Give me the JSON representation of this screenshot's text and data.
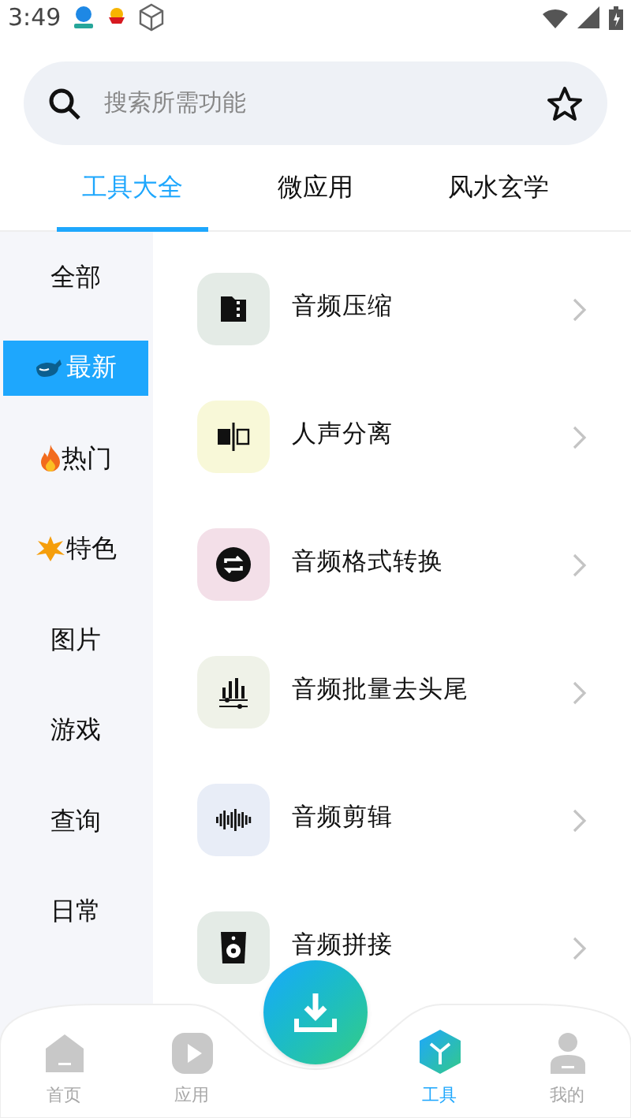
{
  "status_bar": {
    "time": "3:49"
  },
  "search": {
    "placeholder": "搜索所需功能"
  },
  "tabs": [
    {
      "label": "工具大全",
      "selected": true
    },
    {
      "label": "微应用",
      "selected": false
    },
    {
      "label": "风水玄学",
      "selected": false
    }
  ],
  "sidebar": {
    "items": [
      {
        "label": "全部",
        "selected": false
      },
      {
        "label": "最新",
        "selected": true
      },
      {
        "label": "热门",
        "selected": false
      },
      {
        "label": "特色",
        "selected": false
      },
      {
        "label": "图片",
        "selected": false
      },
      {
        "label": "游戏",
        "selected": false
      },
      {
        "label": "查询",
        "selected": false
      },
      {
        "label": "日常",
        "selected": false
      }
    ]
  },
  "tools": [
    {
      "label": "音频压缩",
      "color": "#e4ebe6"
    },
    {
      "label": "人声分离",
      "color": "#f8f8d8"
    },
    {
      "label": "音频格式转换",
      "color": "#f3dfe8"
    },
    {
      "label": "音频批量去头尾",
      "color": "#eff2e8"
    },
    {
      "label": "音频剪辑",
      "color": "#e8edf7"
    },
    {
      "label": "音频拼接",
      "color": "#e4ebe6"
    }
  ],
  "bottom_nav": [
    {
      "label": "首页",
      "selected": false
    },
    {
      "label": "应用",
      "selected": false
    },
    {
      "label": "工具",
      "selected": true
    },
    {
      "label": "我的",
      "selected": false
    }
  ]
}
